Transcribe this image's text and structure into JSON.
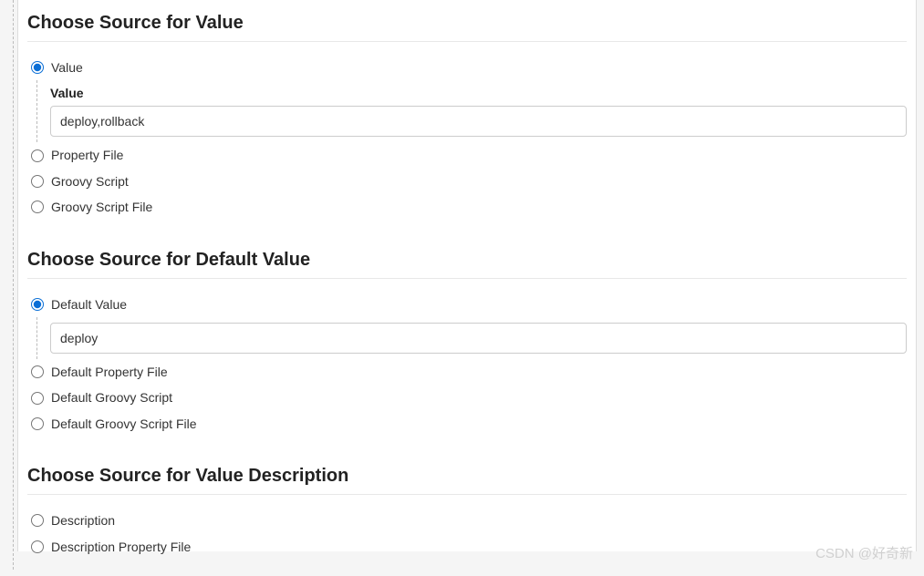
{
  "sections": {
    "value": {
      "title": "Choose Source for Value",
      "options": {
        "value": {
          "label": "Value",
          "selected": true,
          "fieldLabel": "Value",
          "input": "deploy,rollback"
        },
        "propertyFile": {
          "label": "Property File",
          "selected": false
        },
        "groovyScript": {
          "label": "Groovy Script",
          "selected": false
        },
        "groovyScriptFile": {
          "label": "Groovy Script File",
          "selected": false
        }
      }
    },
    "defaultValue": {
      "title": "Choose Source for Default Value",
      "options": {
        "defaultValue": {
          "label": "Default Value",
          "selected": true,
          "input": "deploy"
        },
        "defaultPropertyFile": {
          "label": "Default Property File",
          "selected": false
        },
        "defaultGroovyScript": {
          "label": "Default Groovy Script",
          "selected": false
        },
        "defaultGroovyScriptFile": {
          "label": "Default Groovy Script File",
          "selected": false
        }
      }
    },
    "valueDescription": {
      "title": "Choose Source for Value Description",
      "options": {
        "description": {
          "label": "Description",
          "selected": false
        },
        "descriptionPropertyFile": {
          "label": "Description Property File",
          "selected": false
        }
      }
    }
  },
  "watermark": "CSDN @好奇新"
}
